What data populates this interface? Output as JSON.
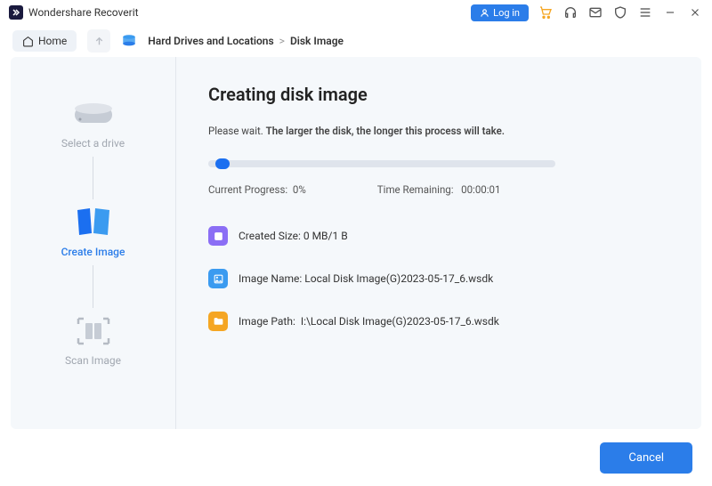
{
  "app": {
    "title": "Wondershare Recoverit",
    "login_label": "Log in"
  },
  "nav": {
    "home_label": "Home",
    "breadcrumb1": "Hard Drives and Locations",
    "breadcrumb2": "Disk Image"
  },
  "steps": {
    "select": "Select a drive",
    "create": "Create Image",
    "scan": "Scan Image"
  },
  "content": {
    "heading": "Creating disk image",
    "subtitle_prefix": "Please wait. ",
    "subtitle_bold": "The larger the disk, the longer this process will take.",
    "progress_label": "Current Progress:",
    "progress_value": "0%",
    "time_label": "Time Remaining:",
    "time_value": "00:00:01",
    "size_label": "Created Size:",
    "size_value": "0 MB/1 B",
    "name_label": "Image Name:",
    "name_value": "Local Disk Image(G)2023-05-17_6.wsdk",
    "path_label": "Image Path:",
    "path_value": "I:\\Local Disk Image(G)2023-05-17_6.wsdk"
  },
  "footer": {
    "cancel_label": "Cancel"
  }
}
